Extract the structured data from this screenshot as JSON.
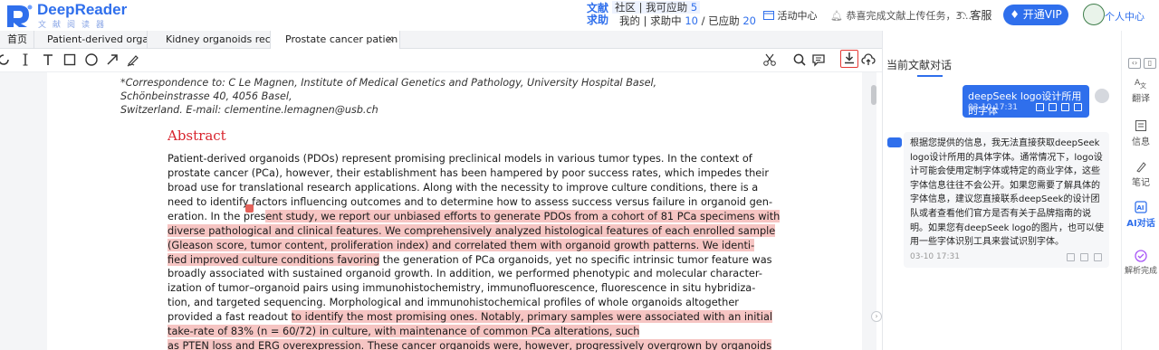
{
  "brand": {
    "name": "DeepReader",
    "subtitle": "文献阅读器"
  },
  "header": {
    "request_label": "文献求助",
    "community": {
      "label": "社区 | 我可应助",
      "count": "5"
    },
    "mine": {
      "label1": "我的 | 求助中",
      "count1": "10",
      "label2": "/ 已应助",
      "count2": "20"
    },
    "activity": "活动中心",
    "notice": "恭喜完成文献上传任务，3...",
    "service": "客服",
    "vip": "开通VIP",
    "user": "个人中心"
  },
  "tabs": [
    {
      "label": "首页"
    },
    {
      "label": "Patient-derived organc"
    },
    {
      "label": "Kidney organoids recap"
    },
    {
      "label": "Prostate cancer patien",
      "close": "×"
    }
  ],
  "document": {
    "correspondence": [
      "*Correspondence to: C Le Magnen, Institute of Medical Genetics and Pathology, University Hospital Basel, Schönbeinstrasse 40, 4056 Basel,",
      "Switzerland. E-mail: clementine.lemagnen@usb.ch"
    ],
    "abstract_title": "Abstract",
    "abstract_lines": [
      {
        "pre": "Patient-derived organoids (PDOs) represent promising preclinical models in various tumor types. In the context of",
        "hl": ""
      },
      {
        "pre": "prostate cancer (PCa), however, their establishment has been hampered by poor success rates, which impedes their",
        "hl": ""
      },
      {
        "pre": "broad use for translational research applications. Along with the necessity to improve culture conditions, there is a",
        "hl": ""
      },
      {
        "pre": "need to identify factors influencing outcomes and to determine how to assess success versus failure in organoid gen-",
        "hl": ""
      },
      {
        "pre": "eration. In the pres",
        "hl": "ent study, we report our unbiased efforts to generate PDOs from a cohort of 81 PCa specimens with"
      },
      {
        "pre": "",
        "hl": "diverse pathological and clinical features. We comprehensively analyzed histological features of each enrolled sample"
      },
      {
        "pre": "",
        "hl": "(Gleason score, tumor content, proliferation index) and correlated them with organoid growth patterns. We identi-"
      },
      {
        "pre": "",
        "hl": "fied improved culture conditions favoring",
        "post": " the generation of PCa organoids, yet no specific intrinsic tumor feature was"
      },
      {
        "pre": "broadly associated with sustained organoid growth. In addition, we performed phenotypic and molecular character-",
        "hl": ""
      },
      {
        "pre": "ization of tumor–organoid pairs using immunohistochemistry, immunofluorescence, fluorescence in situ hybridiza-",
        "hl": ""
      },
      {
        "pre": "tion, and targeted sequencing. Morphological and immunohistochemical profiles of whole organoids altogether",
        "hl": ""
      },
      {
        "pre": "provided a fast readout ",
        "hl": "to identify the most promising ones. Notably, primary samples were associated with an initial"
      },
      {
        "pre": "",
        "hl": "take-rate of 83% (n = 60/72) in culture, with maintenance of common PCa alterations, such"
      },
      {
        "pre": "",
        "hl": "as PTEN loss and ERG overexpression. These cancer organoids were, however, progressively overgrown by organoids"
      }
    ]
  },
  "panel": {
    "title": "当前文献对话",
    "user_msg": {
      "text": "deepSeek logo设计所用的字体",
      "time": "03-10 17:31"
    },
    "ai_msg": {
      "text": "根据您提供的信息，我无法直接获取deepSeek logo设计所用的具体字体。通常情况下，logo设计可能会使用定制字体或特定的商业字体，这些字体信息往往不会公开。如果您需要了解具体的字体信息，建议您直接联系deepSeek的设计团队或者查看他们官方是否有关于品牌指南的说明。如果您有deepSeek logo的图片，也可以使用一些字体识别工具来尝试识别字体。",
      "time": "03-10 17:31"
    }
  },
  "rail": [
    {
      "label": "翻译"
    },
    {
      "label": "信息"
    },
    {
      "label": "笔记"
    },
    {
      "label": "AI对话"
    },
    {
      "label": "解析完成"
    }
  ],
  "colors": {
    "brand": "#2f6fec",
    "highlight": "#f6c5c3",
    "abstract": "#d8242e",
    "download_box": "#e53935"
  }
}
